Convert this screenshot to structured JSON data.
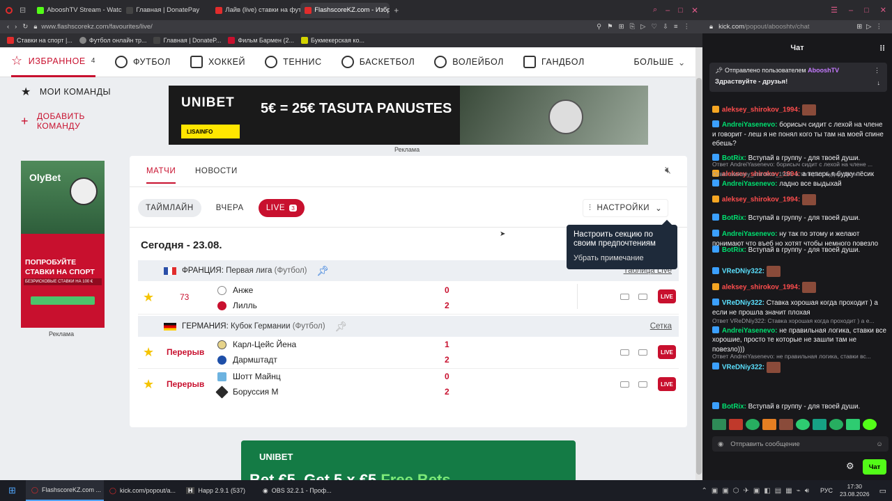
{
  "browser": {
    "tabs": [
      {
        "label": "AbooshTV Stream - Watch",
        "fav": "#53fc18"
      },
      {
        "label": "Главная | DonatePay",
        "fav": "#222"
      },
      {
        "label": "Лайв (live) ставки на фут",
        "fav": "#e12c2c"
      },
      {
        "label": "FlashscoreKZ.com - Избра",
        "fav": "#e12c2c"
      }
    ],
    "url": "www.flashscorekz.com/favourites/live/",
    "bookmarks": [
      "Ставки на спорт |...",
      "Футбол онлайн тр...",
      "Главная | DonateP...",
      "Фильм Бармен (2...",
      "Букмекерская ко..."
    ]
  },
  "nav": {
    "favorites": "ИЗБРАННОЕ",
    "favorites_count": "4",
    "items": [
      "ФУТБОЛ",
      "ХОККЕЙ",
      "ТЕННИС",
      "БАСКЕТБОЛ",
      "ВОЛЕЙБОЛ",
      "ГАНДБОЛ"
    ],
    "more": "БОЛЬШЕ"
  },
  "sidebar": {
    "my_teams": "МОИ КОМАНДЫ",
    "add_team_1": "ДОБАВИТЬ",
    "add_team_2": "КОМАНДУ",
    "ad_label": "Реклама",
    "ad_brand": "OlyBet",
    "ad_text_1": "ПОПРОБУЙТЕ",
    "ad_text_2": "СТАВКИ НА СПОРТ",
    "ad_text_3": "БЕЗРИСКОВЫЕ СТАВКИ НА 100 €"
  },
  "banner": {
    "brand": "UNIBET",
    "headline": "5€ = 25€ TASUTA PANUSTES",
    "cta": "LISAINFO",
    "label": "Реклама"
  },
  "tabs": {
    "matches": "МАТЧИ",
    "news": "НОВОСТИ"
  },
  "filters": {
    "timeline": "ТАЙМЛАЙН",
    "yesterday": "ВЧЕРА",
    "live": "LIVE",
    "live_count": "3",
    "settings": "НАСТРОЙКИ"
  },
  "tooltip": {
    "text": "Настроить секцию по своим предпочтениям",
    "dismiss": "Убрать примечание"
  },
  "date": "Сегодня - 23.08.",
  "leagues": [
    {
      "country": "ФРАНЦИЯ:",
      "name": "Первая лига",
      "sport": "(Футбол)",
      "link": "Таблица Live"
    },
    {
      "country": "ГЕРМАНИЯ:",
      "name": "Кубок Германии",
      "sport": "(Футбол)",
      "link": "Сетка"
    }
  ],
  "matches": [
    {
      "status": "73",
      "home": "Анже",
      "away": "Лилль",
      "home_score": "0",
      "away_score": "2"
    },
    {
      "status": "Перерыв",
      "home": "Карл-Цейс Йена",
      "away": "Дармштадт",
      "home_score": "1",
      "away_score": "2"
    },
    {
      "status": "Перерыв",
      "home": "Шотт Майнц",
      "away": "Боруссия М",
      "home_score": "0",
      "away_score": "2"
    }
  ],
  "live_badge": "LIVE",
  "bottom_ad": {
    "brand": "UNIBET",
    "text": "Bet €5, Get 5 x €5",
    "highlight": "Free Bets"
  },
  "chat": {
    "url_host": "kick.com",
    "url_path": "/popout/abooshtv/chat",
    "title": "Чат",
    "pinned_by": "Отправлено пользователем",
    "pinned_user": "AbooshTV",
    "pinned_text": "Здраствуйте - друзья!",
    "messages": [
      {
        "user": "aleksey_shirokov_1994:",
        "text": "",
        "color": "red",
        "reply": ""
      },
      {
        "user": "AndreiYasenevo:",
        "text": "борисыч сидит с лехой на члене и говорит - леш я не понял кого ты там на моей спине ебешь?",
        "color": "green",
        "reply": ""
      },
      {
        "user": "BotRix:",
        "text": "Вступай в группу - для твоей души.",
        "color": "green",
        "reply": ""
      },
      {
        "user": "aleksey_shirokov_1994:",
        "text": "а теперь в будку пёсик",
        "color": "red",
        "reply": "Ответ AndreiYasenevo: борисыч сидит с лехой на члене ..."
      },
      {
        "user": "AndreiYasenevo:",
        "text": "ладно все выдыхай",
        "color": "green",
        "reply": "Ответ aleksey_shirokov_1994: а теперь в будку пёсик"
      },
      {
        "user": "aleksey_shirokov_1994:",
        "text": "",
        "color": "red",
        "reply": ""
      },
      {
        "user": "BotRix:",
        "text": "Вступай в группу - для твоей души.",
        "color": "green",
        "reply": ""
      },
      {
        "user": "AndreiYasenevo:",
        "text": "ну так по этому и желают понимают что въеб но хотят чтобы немного повезло",
        "color": "green",
        "reply": ""
      },
      {
        "user": "BotRix:",
        "text": "Вступай в группу - для твоей души.",
        "color": "green",
        "reply": ""
      },
      {
        "user": "VReDNiy322:",
        "text": "",
        "color": "cyan",
        "reply": ""
      },
      {
        "user": "aleksey_shirokov_1994:",
        "text": "",
        "color": "red",
        "reply": ""
      },
      {
        "user": "VReDNiy322:",
        "text": "Ставка хорошая когда проходит ) а если не прошла значит плохая",
        "color": "cyan",
        "reply": ""
      },
      {
        "user": "AndreiYasenevo:",
        "text": "не правильная логика, ставки все хорошие, просто те которые не зашли там не повезло)))",
        "color": "green",
        "reply": "Ответ VReDNiy322: Ставка хорошая когда проходит ) а е..."
      },
      {
        "user": "VReDNiy322:",
        "text": "",
        "color": "cyan",
        "reply": "Ответ AndreiYasenevo: не правильная логика, ставки вс..."
      },
      {
        "user": "BotRix:",
        "text": "Вступай в группу - для твоей души.",
        "color": "green",
        "reply": ""
      }
    ],
    "input_placeholder": "Отправить сообщение",
    "send": "Чат"
  },
  "taskbar": {
    "items": [
      "FlashscoreKZ.com ...",
      "kick.com/popout/a...",
      "Happ 2.9.1 (537)",
      "OBS 32.2.1 - Проф..."
    ],
    "lang": "РУС",
    "time": "17:30",
    "date": "23.08.2026"
  }
}
